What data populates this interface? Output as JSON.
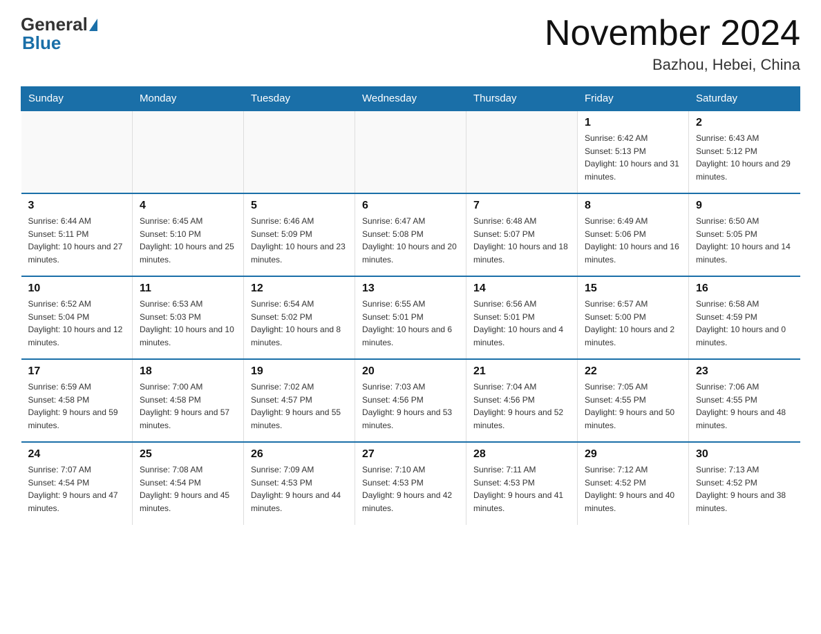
{
  "header": {
    "logo_general": "General",
    "logo_blue": "Blue",
    "month_title": "November 2024",
    "location": "Bazhou, Hebei, China"
  },
  "days_of_week": [
    "Sunday",
    "Monday",
    "Tuesday",
    "Wednesday",
    "Thursday",
    "Friday",
    "Saturday"
  ],
  "weeks": [
    [
      {
        "day": "",
        "info": ""
      },
      {
        "day": "",
        "info": ""
      },
      {
        "day": "",
        "info": ""
      },
      {
        "day": "",
        "info": ""
      },
      {
        "day": "",
        "info": ""
      },
      {
        "day": "1",
        "info": "Sunrise: 6:42 AM\nSunset: 5:13 PM\nDaylight: 10 hours and 31 minutes."
      },
      {
        "day": "2",
        "info": "Sunrise: 6:43 AM\nSunset: 5:12 PM\nDaylight: 10 hours and 29 minutes."
      }
    ],
    [
      {
        "day": "3",
        "info": "Sunrise: 6:44 AM\nSunset: 5:11 PM\nDaylight: 10 hours and 27 minutes."
      },
      {
        "day": "4",
        "info": "Sunrise: 6:45 AM\nSunset: 5:10 PM\nDaylight: 10 hours and 25 minutes."
      },
      {
        "day": "5",
        "info": "Sunrise: 6:46 AM\nSunset: 5:09 PM\nDaylight: 10 hours and 23 minutes."
      },
      {
        "day": "6",
        "info": "Sunrise: 6:47 AM\nSunset: 5:08 PM\nDaylight: 10 hours and 20 minutes."
      },
      {
        "day": "7",
        "info": "Sunrise: 6:48 AM\nSunset: 5:07 PM\nDaylight: 10 hours and 18 minutes."
      },
      {
        "day": "8",
        "info": "Sunrise: 6:49 AM\nSunset: 5:06 PM\nDaylight: 10 hours and 16 minutes."
      },
      {
        "day": "9",
        "info": "Sunrise: 6:50 AM\nSunset: 5:05 PM\nDaylight: 10 hours and 14 minutes."
      }
    ],
    [
      {
        "day": "10",
        "info": "Sunrise: 6:52 AM\nSunset: 5:04 PM\nDaylight: 10 hours and 12 minutes."
      },
      {
        "day": "11",
        "info": "Sunrise: 6:53 AM\nSunset: 5:03 PM\nDaylight: 10 hours and 10 minutes."
      },
      {
        "day": "12",
        "info": "Sunrise: 6:54 AM\nSunset: 5:02 PM\nDaylight: 10 hours and 8 minutes."
      },
      {
        "day": "13",
        "info": "Sunrise: 6:55 AM\nSunset: 5:01 PM\nDaylight: 10 hours and 6 minutes."
      },
      {
        "day": "14",
        "info": "Sunrise: 6:56 AM\nSunset: 5:01 PM\nDaylight: 10 hours and 4 minutes."
      },
      {
        "day": "15",
        "info": "Sunrise: 6:57 AM\nSunset: 5:00 PM\nDaylight: 10 hours and 2 minutes."
      },
      {
        "day": "16",
        "info": "Sunrise: 6:58 AM\nSunset: 4:59 PM\nDaylight: 10 hours and 0 minutes."
      }
    ],
    [
      {
        "day": "17",
        "info": "Sunrise: 6:59 AM\nSunset: 4:58 PM\nDaylight: 9 hours and 59 minutes."
      },
      {
        "day": "18",
        "info": "Sunrise: 7:00 AM\nSunset: 4:58 PM\nDaylight: 9 hours and 57 minutes."
      },
      {
        "day": "19",
        "info": "Sunrise: 7:02 AM\nSunset: 4:57 PM\nDaylight: 9 hours and 55 minutes."
      },
      {
        "day": "20",
        "info": "Sunrise: 7:03 AM\nSunset: 4:56 PM\nDaylight: 9 hours and 53 minutes."
      },
      {
        "day": "21",
        "info": "Sunrise: 7:04 AM\nSunset: 4:56 PM\nDaylight: 9 hours and 52 minutes."
      },
      {
        "day": "22",
        "info": "Sunrise: 7:05 AM\nSunset: 4:55 PM\nDaylight: 9 hours and 50 minutes."
      },
      {
        "day": "23",
        "info": "Sunrise: 7:06 AM\nSunset: 4:55 PM\nDaylight: 9 hours and 48 minutes."
      }
    ],
    [
      {
        "day": "24",
        "info": "Sunrise: 7:07 AM\nSunset: 4:54 PM\nDaylight: 9 hours and 47 minutes."
      },
      {
        "day": "25",
        "info": "Sunrise: 7:08 AM\nSunset: 4:54 PM\nDaylight: 9 hours and 45 minutes."
      },
      {
        "day": "26",
        "info": "Sunrise: 7:09 AM\nSunset: 4:53 PM\nDaylight: 9 hours and 44 minutes."
      },
      {
        "day": "27",
        "info": "Sunrise: 7:10 AM\nSunset: 4:53 PM\nDaylight: 9 hours and 42 minutes."
      },
      {
        "day": "28",
        "info": "Sunrise: 7:11 AM\nSunset: 4:53 PM\nDaylight: 9 hours and 41 minutes."
      },
      {
        "day": "29",
        "info": "Sunrise: 7:12 AM\nSunset: 4:52 PM\nDaylight: 9 hours and 40 minutes."
      },
      {
        "day": "30",
        "info": "Sunrise: 7:13 AM\nSunset: 4:52 PM\nDaylight: 9 hours and 38 minutes."
      }
    ]
  ]
}
